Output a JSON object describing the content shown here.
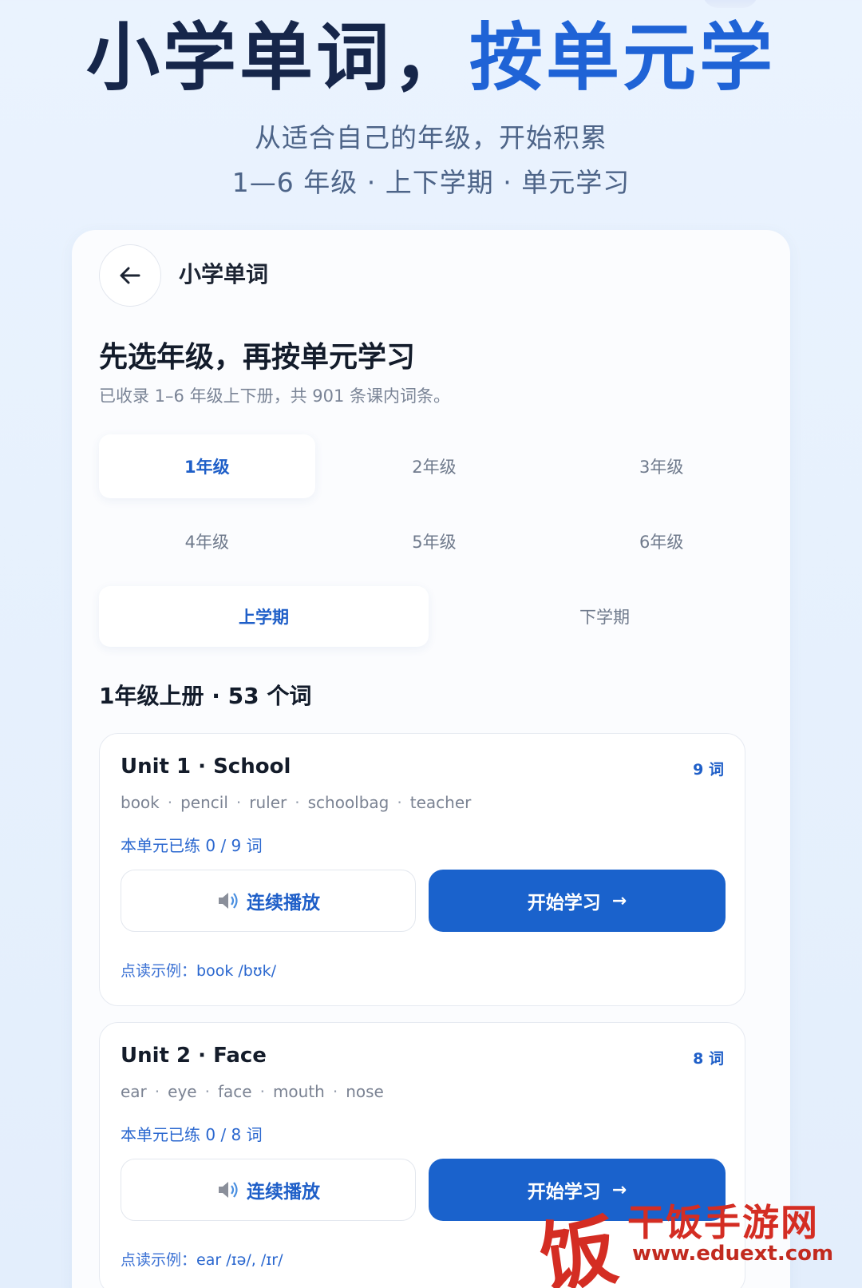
{
  "hero": {
    "title_dark": "小学单词，",
    "title_blue": "按单元学",
    "subtitle_1": "从适合自己的年级，开始积累",
    "subtitle_2": "1—6 年级 · 上下学期 · 单元学习"
  },
  "nav": {
    "back_icon": "arrow-left-icon",
    "title": "小学单词"
  },
  "section": {
    "heading": "先选年级，再按单元学习",
    "desc": "已收录 1–6 年级上下册，共 901 条课内词条。"
  },
  "grades": [
    {
      "label": "1年级",
      "active": true
    },
    {
      "label": "2年级",
      "active": false
    },
    {
      "label": "3年级",
      "active": false
    },
    {
      "label": "4年级",
      "active": false
    },
    {
      "label": "5年级",
      "active": false
    },
    {
      "label": "6年级",
      "active": false
    }
  ],
  "terms": [
    {
      "label": "上学期",
      "active": true
    },
    {
      "label": "下学期",
      "active": false
    }
  ],
  "list_heading": "1年级上册 · 53 个词",
  "units": [
    {
      "title": "Unit 1 · School",
      "count": "9 词",
      "words": [
        "book",
        "pencil",
        "ruler",
        "schoolbag",
        "teacher"
      ],
      "progress": "本单元已练 0 / 9 词",
      "play_label": "连续播放",
      "start_label": "开始学习",
      "example_label": "点读示例：",
      "example_value": "book  /bʊk/"
    },
    {
      "title": "Unit 2 · Face",
      "count": "8 词",
      "words": [
        "ear",
        "eye",
        "face",
        "mouth",
        "nose"
      ],
      "progress": "本单元已练 0 / 8 词",
      "play_label": "连续播放",
      "start_label": "开始学习",
      "example_label": "点读示例：",
      "example_value": "ear  /ɪə/, /ɪr/"
    }
  ],
  "watermark": {
    "name": "干饭手游网",
    "url": "www.eduext.com"
  },
  "colors": {
    "accent": "#1a62cc",
    "title_dark": "#16264a",
    "title_blue": "#1f63d6",
    "watermark": "#d42d23"
  }
}
